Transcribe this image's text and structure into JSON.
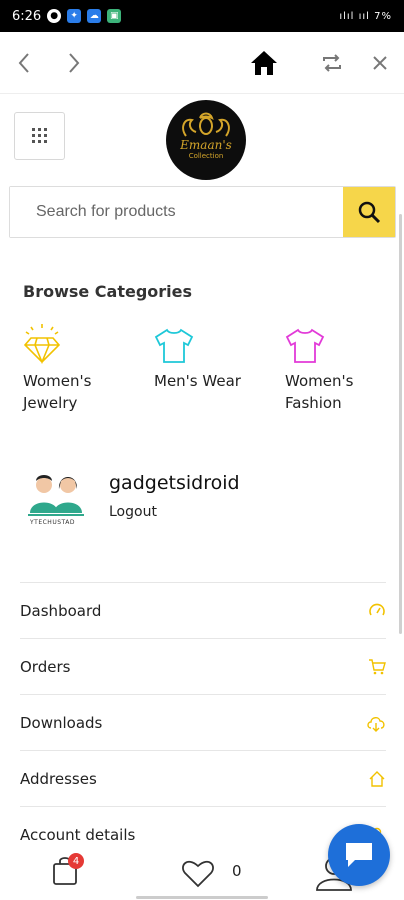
{
  "status_bar": {
    "time": "6:26",
    "signal": "ılıl ııl 7%"
  },
  "logo": {
    "brand": "Emaan's",
    "sub": "Collection"
  },
  "search": {
    "placeholder": "Search for products"
  },
  "browse": {
    "title": "Browse Categories",
    "categories": [
      {
        "label": "Women's Jewelry",
        "icon": "diamond-icon",
        "color": "#f2c200"
      },
      {
        "label": "Men's Wear",
        "icon": "shirt-icon",
        "color": "#1ec8d8"
      },
      {
        "label": "Women's Fashion",
        "icon": "shirt-icon",
        "color": "#e23ad8"
      }
    ]
  },
  "user": {
    "name": "gadgetsidroid",
    "logout": "Logout",
    "avatar_caption": "YTECHUSTAD"
  },
  "account_menu": [
    {
      "label": "Dashboard",
      "icon": "gauge-icon"
    },
    {
      "label": "Orders",
      "icon": "cart-icon"
    },
    {
      "label": "Downloads",
      "icon": "cloud-download-icon"
    },
    {
      "label": "Addresses",
      "icon": "home-icon"
    },
    {
      "label": "Account details",
      "icon": "user-icon"
    }
  ],
  "bottom": {
    "cart_count": "4",
    "wishlist_count": "0"
  },
  "colors": {
    "accent": "#f6d64a",
    "chat": "#1e6fd9",
    "badge": "#e53935",
    "menu_icon": "#f2c200"
  }
}
